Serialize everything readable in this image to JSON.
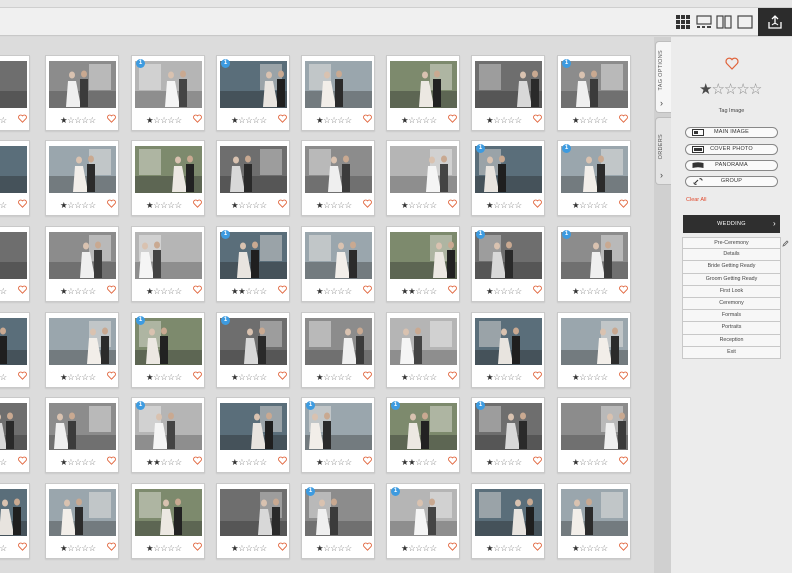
{
  "toolbar": {
    "views": [
      {
        "name": "grid-view",
        "icon": "grid-icon",
        "active": true
      },
      {
        "name": "single-view",
        "icon": "single-image-icon",
        "active": false
      },
      {
        "name": "compare-view",
        "icon": "compare-icon",
        "active": false
      },
      {
        "name": "fullscreen-view",
        "icon": "frame-icon",
        "active": false
      }
    ],
    "upload_icon": "upload-icon"
  },
  "grid": {
    "columns": 8,
    "rows": [
      [
        {
          "tag": false,
          "stars": 1
        },
        {
          "tag": false,
          "stars": 1
        },
        {
          "tag": true,
          "stars": 1
        },
        {
          "tag": true,
          "stars": 1
        },
        {
          "tag": false,
          "stars": 1
        },
        {
          "tag": false,
          "stars": 1
        },
        {
          "tag": false,
          "stars": 1
        },
        {
          "tag": true,
          "stars": 1
        }
      ],
      [
        {
          "tag": false,
          "stars": 1
        },
        {
          "tag": false,
          "stars": 1
        },
        {
          "tag": false,
          "stars": 1
        },
        {
          "tag": false,
          "stars": 1
        },
        {
          "tag": false,
          "stars": 1
        },
        {
          "tag": false,
          "stars": 1
        },
        {
          "tag": true,
          "stars": 1
        },
        {
          "tag": true,
          "stars": 1
        }
      ],
      [
        {
          "tag": false,
          "stars": 1
        },
        {
          "tag": false,
          "stars": 1
        },
        {
          "tag": false,
          "stars": 1
        },
        {
          "tag": true,
          "stars": 2
        },
        {
          "tag": false,
          "stars": 1
        },
        {
          "tag": false,
          "stars": 2
        },
        {
          "tag": true,
          "stars": 1
        },
        {
          "tag": true,
          "stars": 1
        }
      ],
      [
        {
          "tag": false,
          "stars": 1
        },
        {
          "tag": false,
          "stars": 1
        },
        {
          "tag": true,
          "stars": 1
        },
        {
          "tag": true,
          "stars": 1
        },
        {
          "tag": false,
          "stars": 1
        },
        {
          "tag": false,
          "stars": 1
        },
        {
          "tag": false,
          "stars": 1
        },
        {
          "tag": false,
          "stars": 1
        }
      ],
      [
        {
          "tag": false,
          "stars": 1
        },
        {
          "tag": false,
          "stars": 1
        },
        {
          "tag": true,
          "stars": 2
        },
        {
          "tag": false,
          "stars": 1
        },
        {
          "tag": true,
          "stars": 1
        },
        {
          "tag": true,
          "stars": 2
        },
        {
          "tag": true,
          "stars": 1
        },
        {
          "tag": false,
          "stars": 1
        }
      ],
      [
        {
          "tag": false,
          "stars": 1
        },
        {
          "tag": false,
          "stars": 1
        },
        {
          "tag": false,
          "stars": 1
        },
        {
          "tag": false,
          "stars": 1
        },
        {
          "tag": true,
          "stars": 1
        },
        {
          "tag": true,
          "stars": 1
        },
        {
          "tag": false,
          "stars": 1
        },
        {
          "tag": false,
          "stars": 1
        }
      ]
    ],
    "star_glyph_on": "★",
    "star_glyph_off": "☆",
    "heart_color": "#e0633a",
    "badge_color": "#3d9be0",
    "badge_text": "1"
  },
  "side_tabs": [
    {
      "label": "TAG OPTIONS",
      "active": true
    },
    {
      "label": "ORDERS",
      "active": false
    }
  ],
  "panel": {
    "favorite_icon": "heart-icon",
    "rating": 1,
    "rating_max": 5,
    "tag_image_label": "Tag Image",
    "tag_buttons": [
      {
        "label": "MAIN IMAGE",
        "icon": "main-image-icon"
      },
      {
        "label": "COVER PHOTO",
        "icon": "cover-photo-icon"
      },
      {
        "label": "PANORAMA",
        "icon": "panorama-icon"
      },
      {
        "label": "GROUP",
        "icon": "link-icon"
      }
    ],
    "clear_all": "Clear All",
    "category": "WEDDING",
    "sub_categories": [
      "Pre-Ceremony",
      "Details",
      "Bride Getting Ready",
      "Groom Getting Ready",
      "First Look",
      "Ceremony",
      "Formals",
      "Portraits",
      "Reception",
      "Exit"
    ]
  },
  "colors": {
    "accent_red": "#e0472b",
    "dark_bar": "#2f2f2f"
  }
}
